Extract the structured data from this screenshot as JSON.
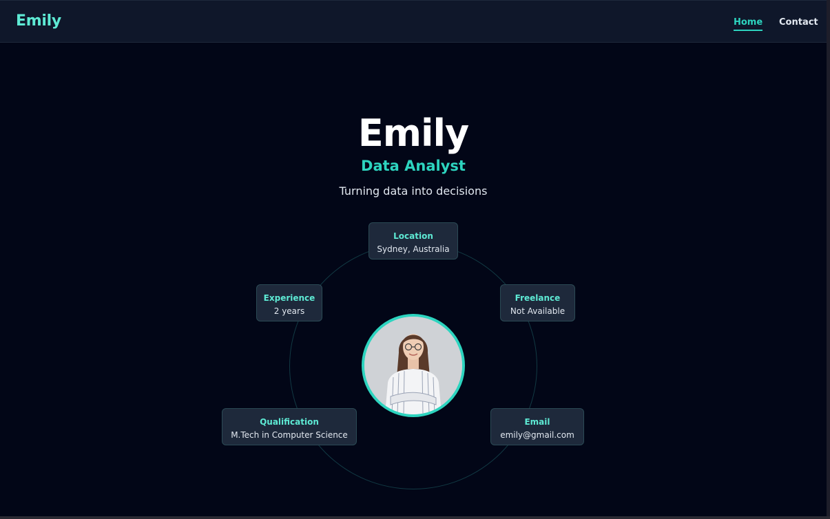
{
  "nav": {
    "brand": "Emily",
    "links": [
      {
        "label": "Home",
        "active": true
      },
      {
        "label": "Contact",
        "active": false
      }
    ]
  },
  "hero": {
    "name": "Emily",
    "role": "Data Analyst",
    "tagline": "Turning data into decisions"
  },
  "info_cards": {
    "location": {
      "label": "Location",
      "value": "Sydney, Australia"
    },
    "experience": {
      "label": "Experience",
      "value": "2 years"
    },
    "freelance": {
      "label": "Freelance",
      "value": "Not Available"
    },
    "qualification": {
      "label": "Qualification",
      "value": "M.Tech in Computer Science"
    },
    "email": {
      "label": "Email",
      "value": "emily@gmail.com"
    }
  },
  "colors": {
    "background": "#020617",
    "navbar": "#0f172a",
    "accent": "#2dd4bf",
    "card": "#1e293b"
  }
}
